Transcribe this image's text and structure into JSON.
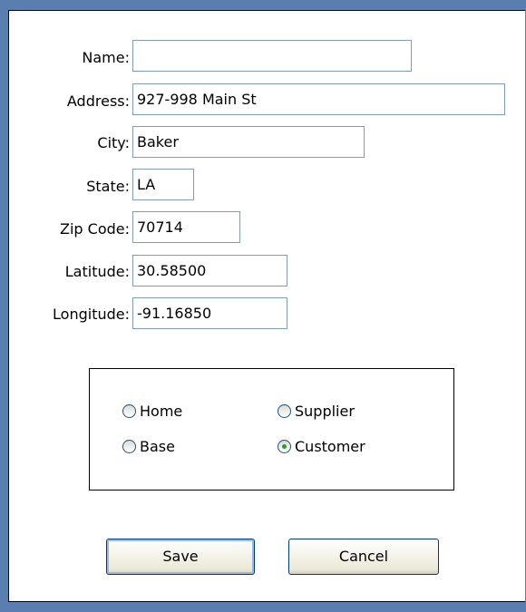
{
  "form": {
    "fields": {
      "name": {
        "label": "Name:",
        "value": ""
      },
      "address": {
        "label": "Address:",
        "value": "927-998 Main St"
      },
      "city": {
        "label": "City:",
        "value": "Baker"
      },
      "state": {
        "label": "State:",
        "value": "LA"
      },
      "zip": {
        "label": "Zip Code:",
        "value": "70714"
      },
      "latitude": {
        "label": "Latitude:",
        "value": "30.58500"
      },
      "longitude": {
        "label": "Longitude:",
        "value": "-91.16850"
      }
    },
    "type_options": [
      {
        "label": "Home",
        "checked": false
      },
      {
        "label": "Supplier",
        "checked": false
      },
      {
        "label": "Base",
        "checked": false
      },
      {
        "label": "Customer",
        "checked": true
      }
    ],
    "buttons": {
      "save": "Save",
      "cancel": "Cancel"
    }
  },
  "colors": {
    "frame": "#5a7eb0",
    "input_border": "#7f9db9",
    "radio_dot": "#21a121",
    "button_border": "#003c74"
  }
}
